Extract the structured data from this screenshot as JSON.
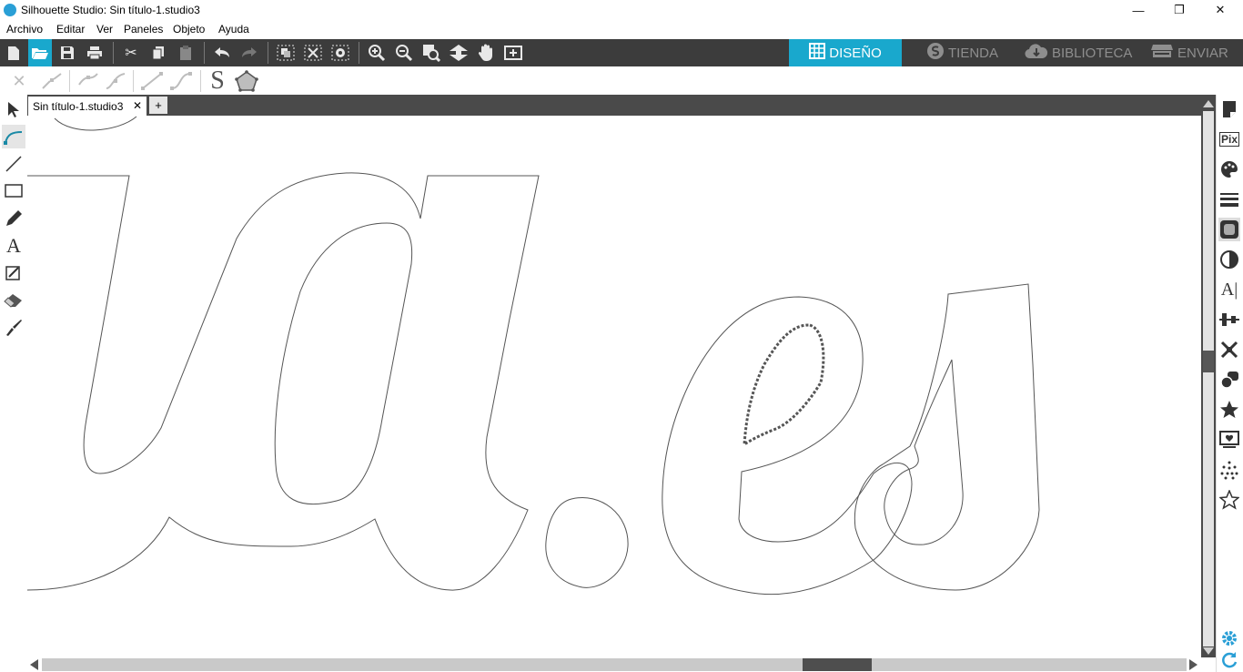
{
  "window": {
    "title": "Silhouette Studio: Sin título-1.studio3",
    "controls": {
      "minimize": "—",
      "maximize": "❐",
      "close": "✕"
    }
  },
  "menu": [
    "Archivo",
    "Editar",
    "Ver",
    "Paneles",
    "Objeto",
    "Ayuda"
  ],
  "toolbar": {
    "file_icons": [
      "new-document-icon",
      "open-folder-icon",
      "save-icon",
      "print-icon"
    ],
    "edit_icons": [
      "cut-icon",
      "copy-icon",
      "paste-icon"
    ],
    "history_icons": [
      "undo-icon",
      "redo-icon"
    ],
    "group_icons": [
      "group-icon",
      "ungroup-icon",
      "compound-path-icon"
    ],
    "view_icons": [
      "zoom-in-icon",
      "zoom-out-icon",
      "zoom-fit-icon",
      "move-down-icon",
      "pan-hand-icon",
      "add-page-icon"
    ]
  },
  "nav_tabs": [
    {
      "label": "DISEÑO",
      "icon": "grid-icon",
      "active": true
    },
    {
      "label": "TIENDA",
      "icon": "store-s-icon",
      "active": false
    },
    {
      "label": "BIBLIOTECA",
      "icon": "cloud-icon",
      "active": false
    },
    {
      "label": "ENVIAR",
      "icon": "cutter-machine-icon",
      "active": false
    }
  ],
  "document": {
    "tab_label": "Sin título-1.studio3",
    "close": "✕",
    "add": "+"
  },
  "left_tools": [
    "select-arrow-icon",
    "edit-points-icon",
    "line-icon",
    "rectangle-icon",
    "pencil-icon",
    "text-icon",
    "trace-icon",
    "eraser-icon",
    "knife-icon"
  ],
  "right_panel": [
    "page-setup-icon",
    "pixscan-icon",
    "fill-color-icon",
    "line-style-icon",
    "offset-icon",
    "replicate-icon",
    "text-style-icon",
    "align-icon",
    "transform-icon",
    "modify-icon",
    "library-star-icon",
    "send-icon",
    "trace-panel-icon",
    "favorite-star-icon"
  ],
  "right_panel_bottom": [
    "settings-gear-icon",
    "sync-icon"
  ],
  "colors": {
    "toolbar_bg": "#3c3c3c",
    "accent": "#19a8cd",
    "doc_tabbar": "#4a4a4a"
  }
}
